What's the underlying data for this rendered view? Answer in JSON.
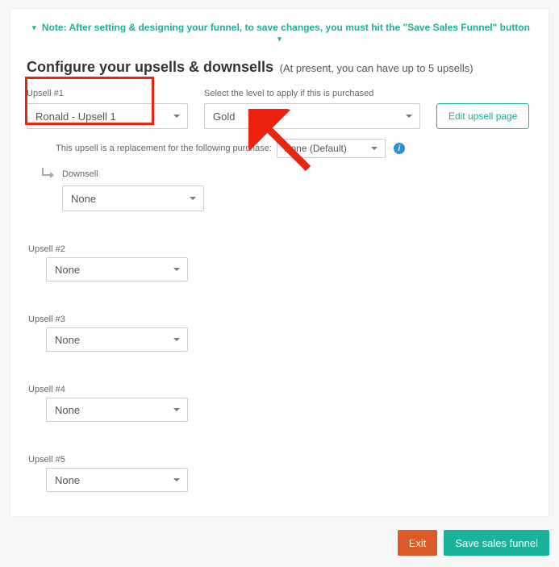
{
  "note": "Note: After setting & designing your funnel, to save changes, you must hit the \"Save Sales Funnel\" button",
  "title": "Configure your upsells & downsells",
  "subtitle": "(At present, you can have up to 5 upsells)",
  "upsell1": {
    "label": "Upsell #1",
    "value": "Ronald - Upsell 1",
    "level_label": "Select the level to apply if this is purchased",
    "level_value": "Gold",
    "edit_button": "Edit upsell page",
    "replace_label": "This upsell is a replacement for the following purchase:",
    "replace_value": "None (Default)",
    "downsell_label": "Downsell",
    "downsell_value": "None"
  },
  "upsells": [
    {
      "label": "Upsell #2",
      "value": "None"
    },
    {
      "label": "Upsell #3",
      "value": "None"
    },
    {
      "label": "Upsell #4",
      "value": "None"
    },
    {
      "label": "Upsell #5",
      "value": "None"
    }
  ],
  "footer": {
    "exit": "Exit",
    "save": "Save sales funnel"
  }
}
